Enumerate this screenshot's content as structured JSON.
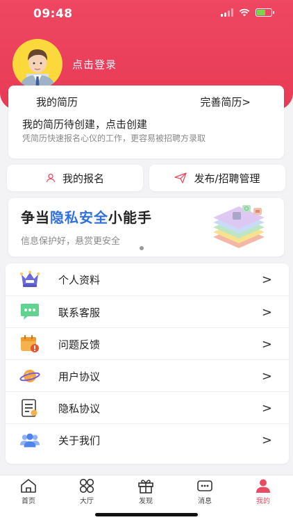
{
  "status_bar": {
    "time": "09:48"
  },
  "profile": {
    "login_text": "点击登录"
  },
  "resume": {
    "title": "我的简历",
    "complete_link": "完善简历>",
    "status": "我的简历待创建，点击创建",
    "hint": "凭简历快速报名心仪的工作，更容易被招聘方录取"
  },
  "actions": {
    "signup": "我的报名",
    "publish": "发布/招聘管理"
  },
  "banner": {
    "title_prefix": "争当",
    "title_highlight": "隐私安全",
    "title_suffix": "小能手",
    "subtitle": "信息保护好，悬赏更安全"
  },
  "menu": {
    "items": [
      {
        "label": "个人资料",
        "icon": "crown-profile-icon"
      },
      {
        "label": "联系客服",
        "icon": "chat-bubble-icon"
      },
      {
        "label": "问题反馈",
        "icon": "calendar-alert-icon"
      },
      {
        "label": "用户协议",
        "icon": "planet-icon"
      },
      {
        "label": "隐私协议",
        "icon": "document-icon"
      },
      {
        "label": "关于我们",
        "icon": "group-icon"
      }
    ],
    "arrow": ">"
  },
  "tabbar": {
    "items": [
      {
        "label": "首页",
        "icon": "home-icon"
      },
      {
        "label": "大厅",
        "icon": "grid-icon"
      },
      {
        "label": "发现",
        "icon": "gift-icon"
      },
      {
        "label": "消息",
        "icon": "message-icon"
      },
      {
        "label": "我的",
        "icon": "person-icon",
        "active": true
      }
    ]
  },
  "colors": {
    "brand": "#e83a55",
    "highlight": "#2f6fe0",
    "active_tab": "#e84c63"
  }
}
